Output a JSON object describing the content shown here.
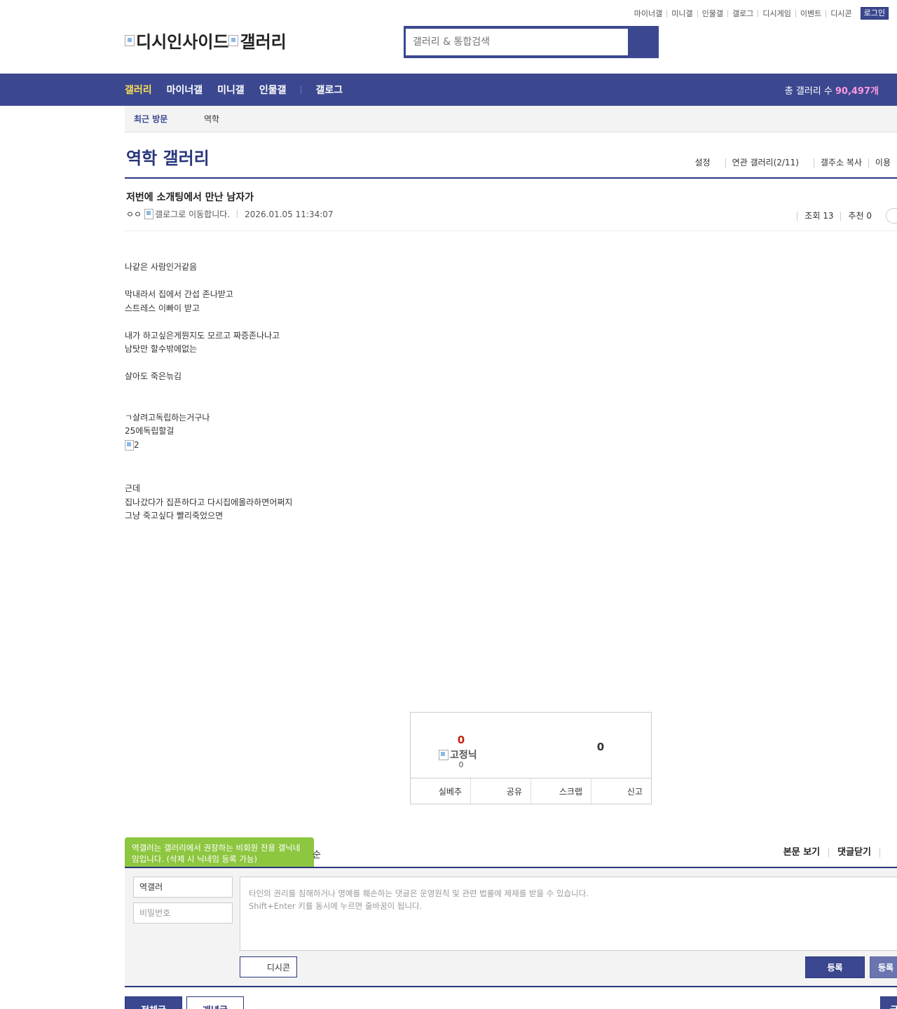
{
  "util_links": [
    "마이너갤",
    "미니갤",
    "인물갤",
    "갤로그",
    "디시게임",
    "이벤트",
    "디시콘"
  ],
  "login_label": "로그인",
  "logo": {
    "part1": "디시인사이드",
    "part2": "갤러리"
  },
  "search": {
    "placeholder": "갤러리 & 통합검색"
  },
  "nav": {
    "items": [
      "갤러리",
      "마이너갤",
      "미니갤",
      "인물갤",
      "갤로그"
    ],
    "total_label": "총 갤러리 수",
    "total_count": "90,497개"
  },
  "recent": {
    "label": "최근 방문",
    "item": "역학"
  },
  "gallery": {
    "title": "역학 갤러리",
    "menu": [
      "설정",
      "연관 갤러리(2/11)",
      "갤주소 복사",
      "이용"
    ]
  },
  "post": {
    "title": "저번에 소개팅에서 만난 남자가",
    "nick": "ㅇㅇ",
    "gallog_alt": "갤로그로 이동합니다.",
    "date": "2026.01.05 11:34:07",
    "views": "조회 13",
    "recommends": "추천 0",
    "body": [
      "나같은 사람인거같음",
      "",
      "막내라서 집에서 간섭 존나받고",
      "스트레스 이빠이 받고",
      "",
      "내가 하고싶은게뭔지도 모르고 짜증존나나고",
      "남탓만 할수밖에없는",
      "",
      "살아도 죽은늒김",
      "",
      "",
      "ㄱ살려고독립하는거구나",
      "25에독립할걸"
    ],
    "image_alt": "2",
    "body2": [
      "근데",
      "집나갔다가 집픈하다고 다시집에올라하면어쩌지",
      "그냥 죽고싶다 빨리죽었으면"
    ]
  },
  "recommend": {
    "up_count": "0",
    "fixed_nick_label": "고정닉",
    "fixed_count": "0",
    "down_count": "0",
    "buttons": [
      "실베추",
      "공유",
      "스크랩",
      "신고"
    ]
  },
  "comments": {
    "tip": "역갤러는 갤러리에서 권장하는 비회원 전용 갤닉네임입니다. (삭제 시 닉네임 등록 가능)",
    "tip_tail": "순",
    "menu": [
      "본문 보기",
      "댓글닫기",
      ""
    ],
    "nick_value": "역갤러",
    "pw_placeholder": "비밀번호",
    "textarea_line1": "타인의 권리를 침해하거나 명예를 훼손하는 댓글은 운영원칙 및 관련 법률에 제재를 받을 수 있습니다.",
    "textarea_line2": "Shift+Enter 키를 동시에 누르면 줄바꿈이 됩니다.",
    "dccon_label": "디시콘",
    "register_label": "등록",
    "register2_label": "등록"
  },
  "bottom_tabs": {
    "all": "전체글",
    "concept": "개념글",
    "right": "글"
  },
  "colors": {
    "brand": "#3b4890",
    "brand_dark": "#29367c",
    "nav_active": "#fcdf54",
    "total_count": "#ff99e1",
    "up_count": "#c3260f",
    "tip": "#8dc63f"
  }
}
